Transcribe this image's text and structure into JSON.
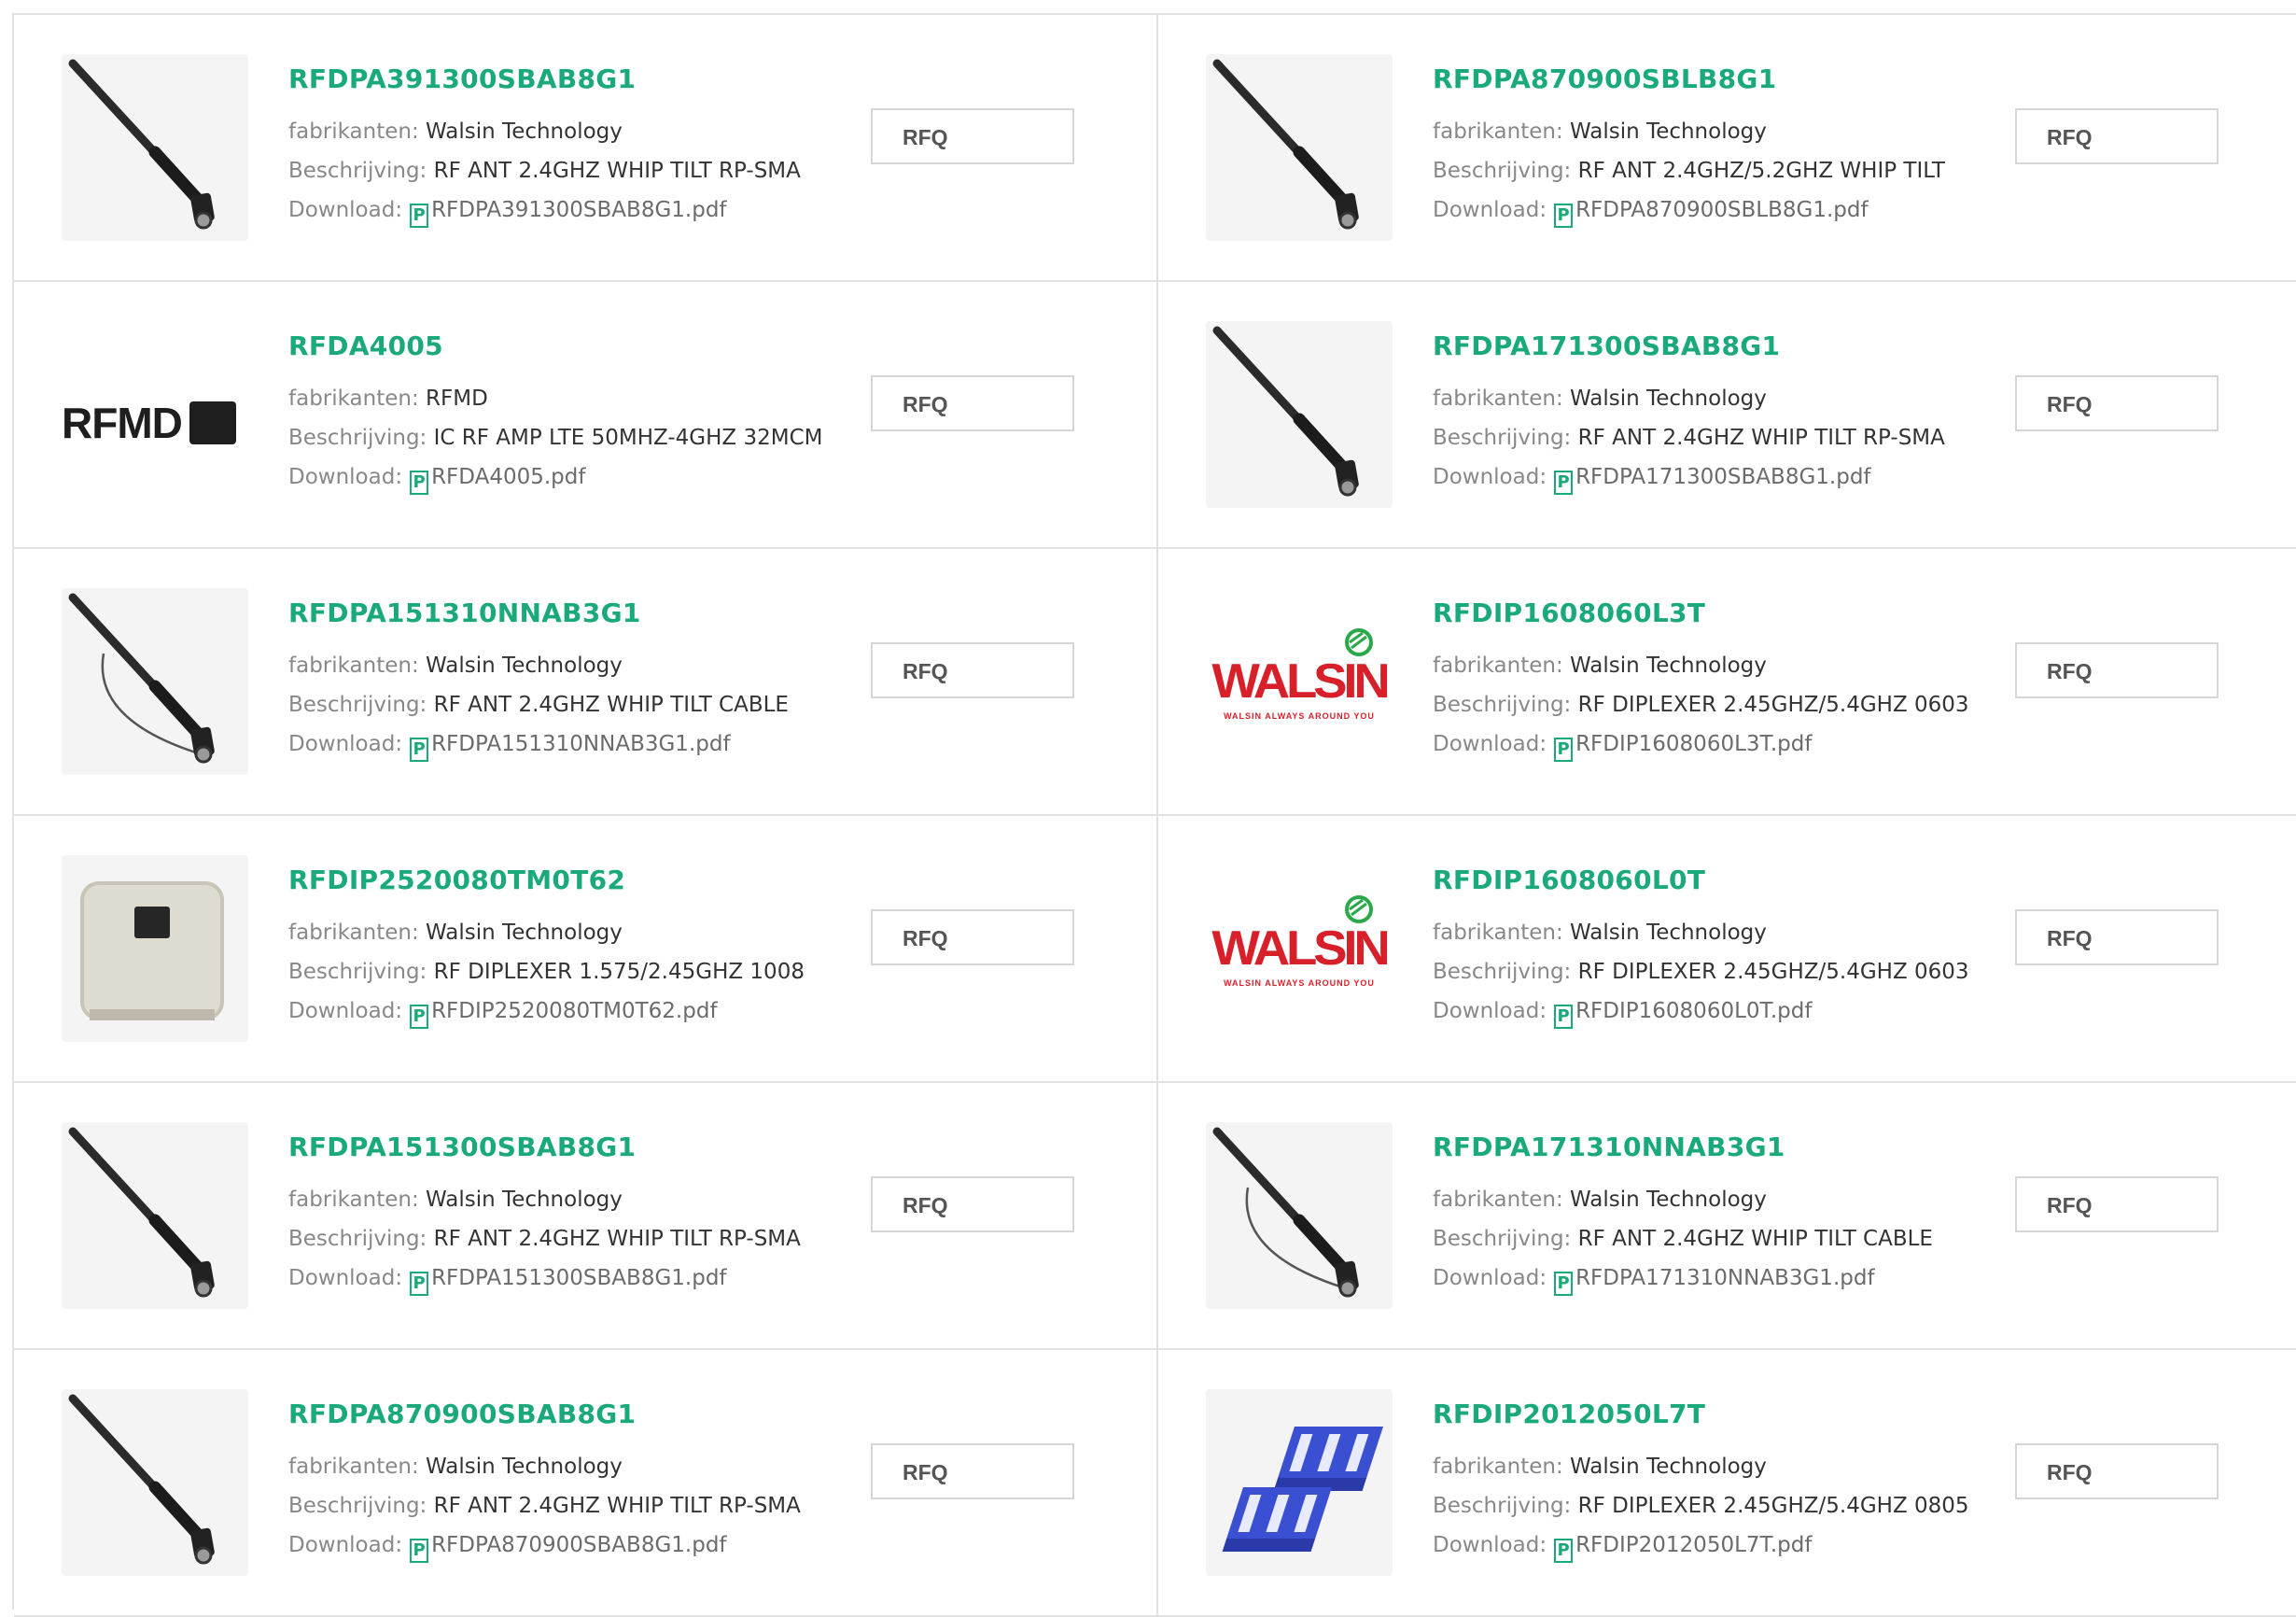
{
  "labels": {
    "manufacturer": "fabrikanten:",
    "description": "Beschrijving:",
    "download": "Download:",
    "rfq": "RFQ",
    "pdf_glyph": "P"
  },
  "products": [
    {
      "part": "RFDPA391300SBAB8G1",
      "manufacturer": "Walsin Technology",
      "description": "RF ANT 2.4GHZ WHIP TILT RP-SMA",
      "file": "RFDPA391300SBAB8G1.pdf",
      "image": "antenna"
    },
    {
      "part": "RFDPA870900SBLB8G1",
      "manufacturer": "Walsin Technology",
      "description": "RF ANT 2.4GHZ/5.2GHZ WHIP TILT",
      "file": "RFDPA870900SBLB8G1.pdf",
      "image": "antenna"
    },
    {
      "part": "RFDA4005",
      "manufacturer": "RFMD",
      "description": "IC RF AMP LTE 50MHZ-4GHZ 32MCM",
      "file": "RFDA4005.pdf",
      "image": "rfmd-logo",
      "logo_text": "RFMD"
    },
    {
      "part": "RFDPA171300SBAB8G1",
      "manufacturer": "Walsin Technology",
      "description": "RF ANT 2.4GHZ WHIP TILT RP-SMA",
      "file": "RFDPA171300SBAB8G1.pdf",
      "image": "antenna"
    },
    {
      "part": "RFDPA151310NNAB3G1",
      "manufacturer": "Walsin Technology",
      "description": "RF ANT 2.4GHZ WHIP TILT CABLE",
      "file": "RFDPA151310NNAB3G1.pdf",
      "image": "antenna-cable"
    },
    {
      "part": "RFDIP1608060L3T",
      "manufacturer": "Walsin Technology",
      "description": "RF DIPLEXER 2.45GHZ/5.4GHZ 0603",
      "file": "RFDIP1608060L3T.pdf",
      "image": "walsin-logo",
      "logo_text": "WALSIN",
      "logo_tagline": "WALSIN ALWAYS AROUND YOU"
    },
    {
      "part": "RFDIP2520080TM0T62",
      "manufacturer": "Walsin Technology",
      "description": "RF DIPLEXER 1.575/2.45GHZ 1008",
      "file": "RFDIP2520080TM0T62.pdf",
      "image": "ceramic-chip"
    },
    {
      "part": "RFDIP1608060L0T",
      "manufacturer": "Walsin Technology",
      "description": "RF DIPLEXER 2.45GHZ/5.4GHZ 0603",
      "file": "RFDIP1608060L0T.pdf",
      "image": "walsin-logo",
      "logo_text": "WALSIN",
      "logo_tagline": "WALSIN ALWAYS AROUND YOU"
    },
    {
      "part": "RFDPA151300SBAB8G1",
      "manufacturer": "Walsin Technology",
      "description": "RF ANT 2.4GHZ WHIP TILT RP-SMA",
      "file": "RFDPA151300SBAB8G1.pdf",
      "image": "antenna"
    },
    {
      "part": "RFDPA171310NNAB3G1",
      "manufacturer": "Walsin Technology",
      "description": "RF ANT 2.4GHZ WHIP TILT CABLE",
      "file": "RFDPA171310NNAB3G1.pdf",
      "image": "antenna-cable"
    },
    {
      "part": "RFDPA870900SBAB8G1",
      "manufacturer": "Walsin Technology",
      "description": "RF ANT 2.4GHZ WHIP TILT RP-SMA",
      "file": "RFDPA870900SBAB8G1.pdf",
      "image": "antenna"
    },
    {
      "part": "RFDIP2012050L7T",
      "manufacturer": "Walsin Technology",
      "description": "RF DIPLEXER 2.45GHZ/5.4GHZ 0805",
      "file": "RFDIP2012050L7T.pdf",
      "image": "blue-chip"
    }
  ],
  "colors": {
    "accent": "#1aa97a",
    "walsin_red": "#d7202a",
    "walsin_green": "#2aa84a",
    "chip_blue": "#3a4fd1"
  }
}
